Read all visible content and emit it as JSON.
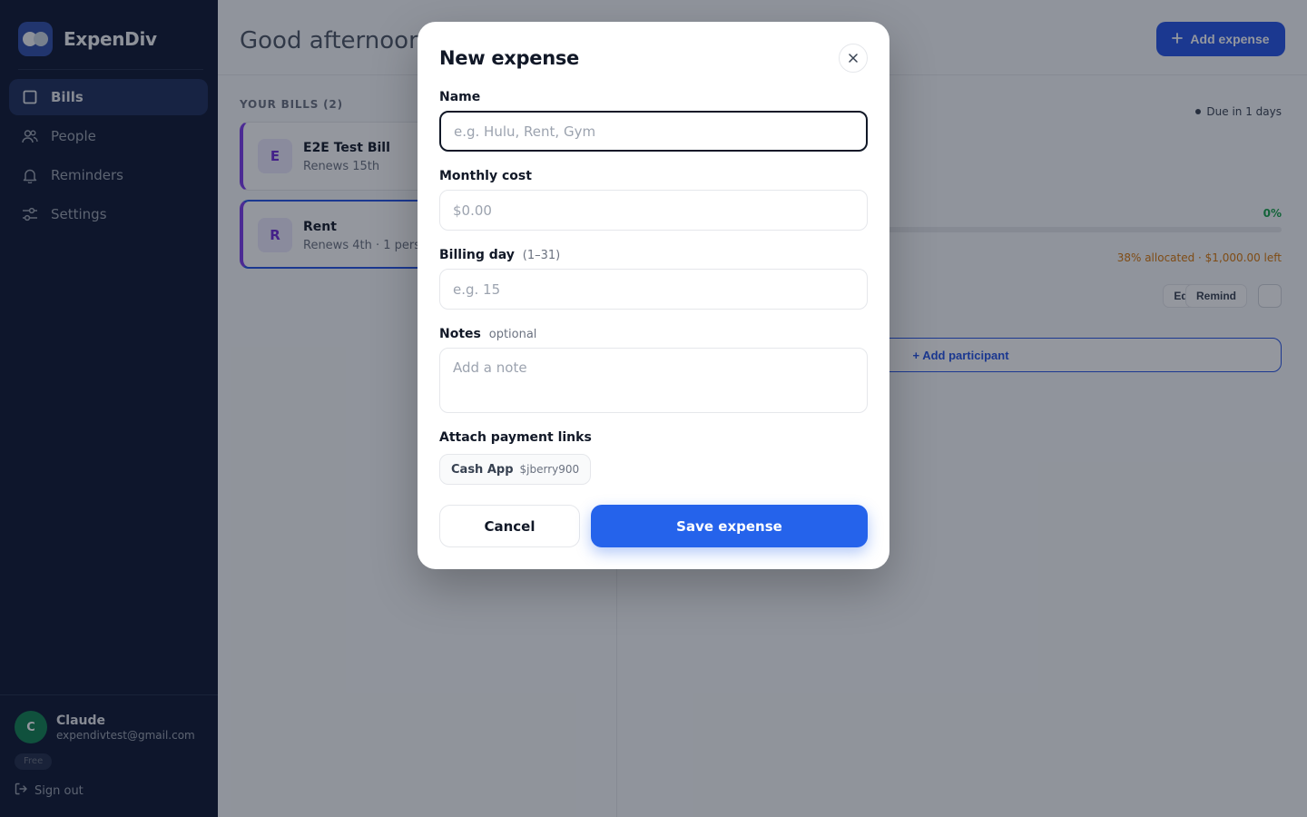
{
  "brand": {
    "name": "ExpenDiv"
  },
  "sidebar": {
    "items": [
      {
        "label": "Bills",
        "icon": "square-icon",
        "active": true
      },
      {
        "label": "People",
        "icon": "people-icon"
      },
      {
        "label": "Reminders",
        "icon": "bell-icon"
      },
      {
        "label": "Settings",
        "icon": "sliders-icon"
      }
    ]
  },
  "user": {
    "initial": "C",
    "name": "Claude",
    "email": "expendivtest@gmail.com",
    "plan": "Free",
    "signout_label": "Sign out"
  },
  "header": {
    "greeting": "Good afternoon,",
    "add_expense_label": "Add expense"
  },
  "bills": {
    "heading": "YOUR BILLS (2)",
    "items": [
      {
        "letter": "E",
        "name": "E2E Test Bill",
        "sub": "Renews 15th"
      },
      {
        "letter": "R",
        "name": "Rent",
        "sub": "Renews 4th · 1 person"
      }
    ]
  },
  "detail": {
    "due": "Due in 1 days",
    "percent": "0%",
    "allocated": "38% allocated · $1,000.00 left",
    "edit_label": "Edit",
    "remind_label": "Remind",
    "add_participant_label": "+ Add participant"
  },
  "modal": {
    "title": "New expense",
    "name": {
      "label": "Name",
      "placeholder": "e.g. Hulu, Rent, Gym",
      "value": ""
    },
    "monthly_cost": {
      "label": "Monthly cost",
      "placeholder": "$0.00",
      "value": ""
    },
    "billing_day": {
      "label": "Billing day",
      "hint": "(1–31)",
      "placeholder": "e.g. 15",
      "value": ""
    },
    "notes": {
      "label": "Notes",
      "hint": "optional",
      "placeholder": "Add a note",
      "value": ""
    },
    "payment_links": {
      "label": "Attach payment links",
      "chips": [
        {
          "name": "Cash App",
          "handle": "$jberry900"
        }
      ]
    },
    "cancel_label": "Cancel",
    "save_label": "Save expense"
  },
  "colors": {
    "sidebar_bg": "#0b1530",
    "accent": "#2563eb",
    "bill_accent": "#7c3aed",
    "success": "#16a34a",
    "warning": "#d97706"
  }
}
